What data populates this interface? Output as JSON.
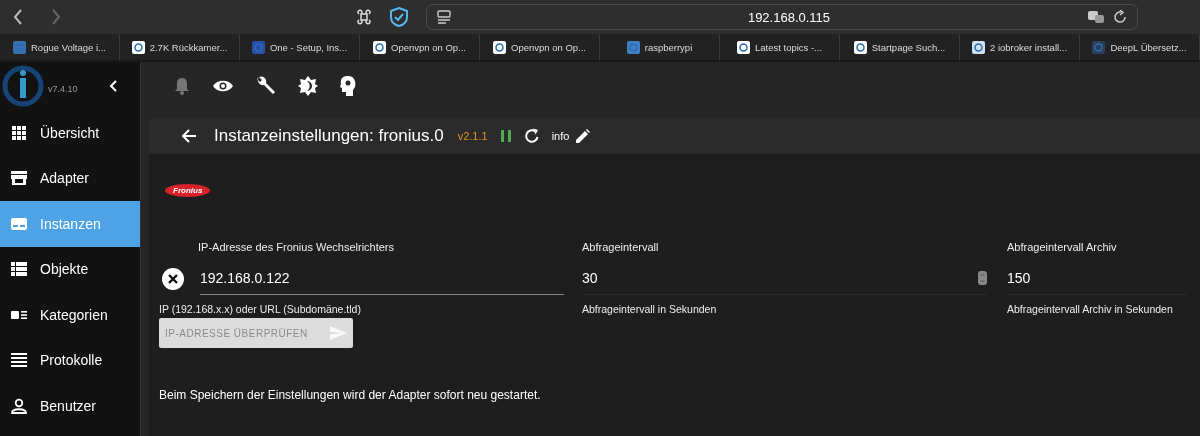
{
  "browser": {
    "url": "192.168.0.115",
    "bookmarks": [
      "Rogue Voltage i...",
      "2.7K Rückkamer...",
      "One - Setup, Ins...",
      "Openvpn on Op...",
      "Openvpn on Op...",
      "raspberrypi",
      "Latest topics -...",
      "Startpage Such...",
      "2 iobroker install...",
      "DeepL Übersetz..."
    ]
  },
  "app": {
    "version": "v7.4.10"
  },
  "sidebar": {
    "items": [
      {
        "label": "Übersicht",
        "selected": false
      },
      {
        "label": "Adapter",
        "selected": false
      },
      {
        "label": "Instanzen",
        "selected": true
      },
      {
        "label": "Objekte",
        "selected": false
      },
      {
        "label": "Kategorien",
        "selected": false
      },
      {
        "label": "Protokolle",
        "selected": false
      },
      {
        "label": "Benutzer",
        "selected": false
      }
    ]
  },
  "header": {
    "title": "Instanzeinstellungen: fronius.0",
    "version": "v2.1.1",
    "info": "info"
  },
  "logo": {
    "text": "Fronius"
  },
  "fields": [
    {
      "label": "IP-Adresse des Fronius Wechselrichters",
      "value": "192.168.0.122",
      "help": "IP (192.168.x.x) oder URL (Subdomäne.tld)",
      "kind": "text"
    },
    {
      "label": "Abfrageintervall",
      "value": "30",
      "help": "Abfrageintervall in Sekunden",
      "kind": "number"
    },
    {
      "label": "Abfrageintervall Archiv",
      "value": "150",
      "help": "Abfrageintervall Archiv in Sekunden",
      "kind": "plain"
    }
  ],
  "check_button": {
    "label": "IP-ADRESSE ÜBERPRÜFEN",
    "disabled": true
  },
  "note": "Beim Speichern der Einstellungen wird der Adapter sofort neu gestartet."
}
